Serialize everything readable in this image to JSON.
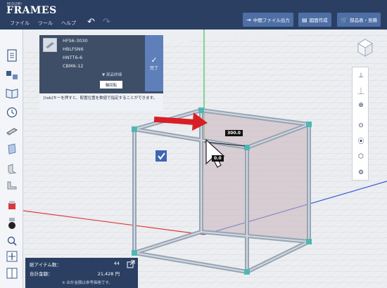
{
  "header": {
    "logo_small": "MiSUMi",
    "logo_big": "FRAMES",
    "menu": [
      "ファイル",
      "ツール",
      "ヘルプ"
    ],
    "buttons": [
      "中間ファイル出力",
      "図面作成",
      "部品表・見積"
    ]
  },
  "part_panel": {
    "parts": [
      "HFS6-3030",
      "HBLFSN6",
      "HNTT6-6",
      "CBM6-12"
    ],
    "detail_label": "▼ 部品詳細",
    "rotate_label": "軸回転",
    "done_label": "完了",
    "hint": "[tab]キーを押すと、配置位置を数値で指定することができます。"
  },
  "viewport": {
    "dimension_label": "300.0",
    "dimension_label_2": "0.0",
    "checkbox_checked": true
  },
  "summary": {
    "total_items_label": "総アイテム数：",
    "total_items_value": "44",
    "total_price_label": "合計金額：",
    "total_price_value": "21,428 円",
    "note": "※ 合計金額は参考価格です。"
  },
  "colors": {
    "header": "#2b3f63",
    "accent_button": "#4d6fa5",
    "done_button": "#5f7fba",
    "arrow": "#d81f26",
    "axis_green": "#3ec34a",
    "axis_red": "#e03a3a",
    "axis_blue": "#3b5bd6"
  }
}
